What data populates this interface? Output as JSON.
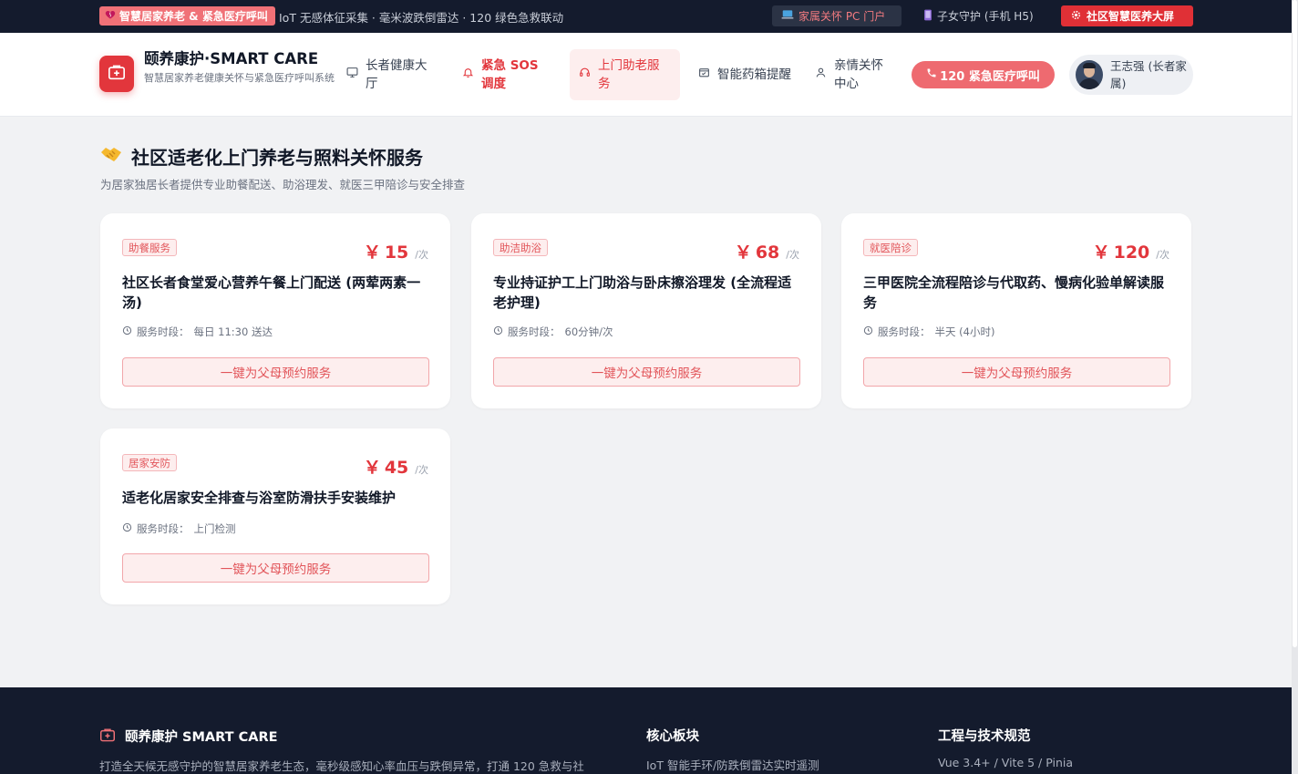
{
  "topbar": {
    "badge_label": "智慧居家养老 & 紧急医疗呼叫",
    "tagline": "IoT 无感体征采集 · 毫米波跌倒雷达 · 120 绿色急救联动",
    "pc_portal_label": "家属关怀 PC 门户",
    "h5_label": "子女守护 (手机 H5)",
    "screen_label": "社区智慧医养大屏"
  },
  "header": {
    "brand_title": "颐养康护·SMART CARE",
    "brand_sub": "智慧居家养老健康关怀与紧急医疗呼叫系统",
    "nav": [
      {
        "label": "长者健康大厅",
        "icon": "monitor-icon"
      },
      {
        "label": "紧急 SOS 调度",
        "icon": "bell-icon"
      },
      {
        "label": "上门助老服务",
        "icon": "headset-icon"
      },
      {
        "label": "智能药箱提醒",
        "icon": "pill-box-icon"
      },
      {
        "label": "亲情关怀中心",
        "icon": "user-icon"
      }
    ],
    "active_nav": "上门助老服务",
    "call_label": "120 紧急医疗呼叫",
    "user_name": "王志强 (长者家属)"
  },
  "main": {
    "title": "社区适老化上门养老与照料关怀服务",
    "subtitle": "为居家独居长者提供专业助餐配送、助浴理发、就医三甲陪诊与安全排查",
    "time_prefix": "服务时段：",
    "currency": "￥",
    "unit": "/次",
    "book_label": "一键为父母预约服务",
    "cards": [
      {
        "tag": "助餐服务",
        "price": "15",
        "title": "社区长者食堂爱心营养午餐上门配送 (两荤两素一汤)",
        "time": "每日 11:30 送达"
      },
      {
        "tag": "助洁助浴",
        "price": "68",
        "title": "专业持证护工上门助浴与卧床擦浴理发 (全流程适老护理)",
        "time": "60分钟/次"
      },
      {
        "tag": "就医陪诊",
        "price": "120",
        "title": "三甲医院全流程陪诊与代取药、慢病化验单解读服务",
        "time": "半天 (4小时)"
      },
      {
        "tag": "居家安防",
        "price": "45",
        "title": "适老化居家安全排查与浴室防滑扶手安装维护",
        "time": "上门检测"
      }
    ]
  },
  "footer": {
    "brand": "颐养康护 SMART CARE",
    "desc": "打造全天候无感守护的智慧居家养老生态，毫秒级感知心率血压与跌倒异常，打通 120 急救与社",
    "col1_title": "核心板块",
    "col1_line": "IoT 智能手环/防跌倒雷达实时遥测",
    "col2_title": "工程与技术规范",
    "col2_line": "Vue 3.4+ / Vite 5 / Pinia"
  },
  "colors": {
    "brand_red": "#e2363c",
    "soft_red": "#fdeeee",
    "dark_navy": "#141b2d"
  }
}
